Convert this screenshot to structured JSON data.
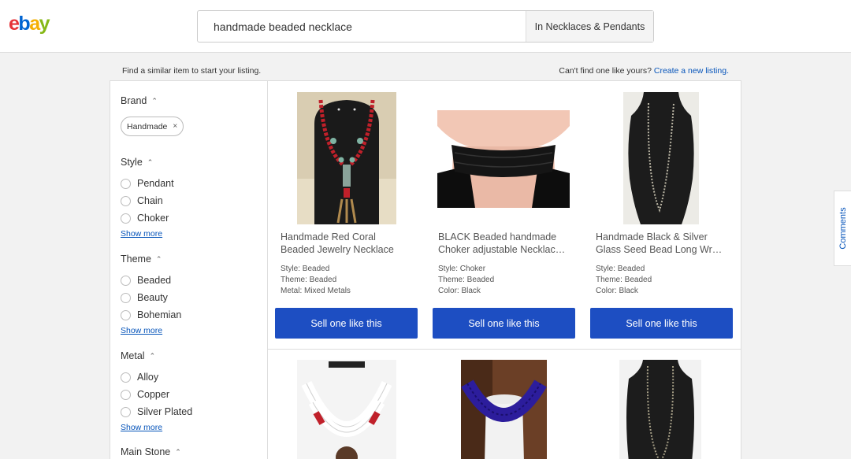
{
  "header": {
    "logo_letters": [
      "e",
      "b",
      "a",
      "y"
    ],
    "search_value": "handmade beaded necklace",
    "category": "In Necklaces & Pendants"
  },
  "info": {
    "left_text": "Find a similar item to start your listing.",
    "right_text": "Can't find one like yours?",
    "right_link": "Create a new listing."
  },
  "sidebar": {
    "brand": {
      "title": "Brand",
      "chip": "Handmade"
    },
    "style": {
      "title": "Style",
      "options": [
        "Pendant",
        "Chain",
        "Choker"
      ],
      "more": "Show more"
    },
    "theme": {
      "title": "Theme",
      "options": [
        "Beaded",
        "Beauty",
        "Bohemian"
      ],
      "more": "Show more"
    },
    "metal": {
      "title": "Metal",
      "options": [
        "Alloy",
        "Copper",
        "Silver Plated"
      ],
      "more": "Show more"
    },
    "main_stone": {
      "title": "Main Stone"
    }
  },
  "listings": [
    {
      "title_line1": "Handmade Red Coral",
      "title_line2": "Beaded Jewelry Necklace",
      "spec1": "Style: Beaded",
      "spec2": "Theme: Beaded",
      "spec3": "Metal: Mixed Metals",
      "button": "Sell one like this"
    },
    {
      "title_line1": "BLACK Beaded handmade",
      "title_line2": "Choker adjustable Necklac…",
      "spec1": "Style: Choker",
      "spec2": "Theme: Beaded",
      "spec3": "Color: Black",
      "button": "Sell one like this"
    },
    {
      "title_line1": "Handmade Black & Silver",
      "title_line2": "Glass Seed Bead Long Wr…",
      "spec1": "Style: Beaded",
      "spec2": "Theme: Beaded",
      "spec3": "Color: Black",
      "button": "Sell one like this"
    }
  ],
  "comments_tab": "Comments",
  "colors": {
    "brand_red": "#e53238",
    "brand_blue": "#0064d2",
    "brand_yellow": "#f5af02",
    "brand_green": "#86b817",
    "button_blue": "#1d4ec2",
    "link_blue": "#0654ba"
  }
}
